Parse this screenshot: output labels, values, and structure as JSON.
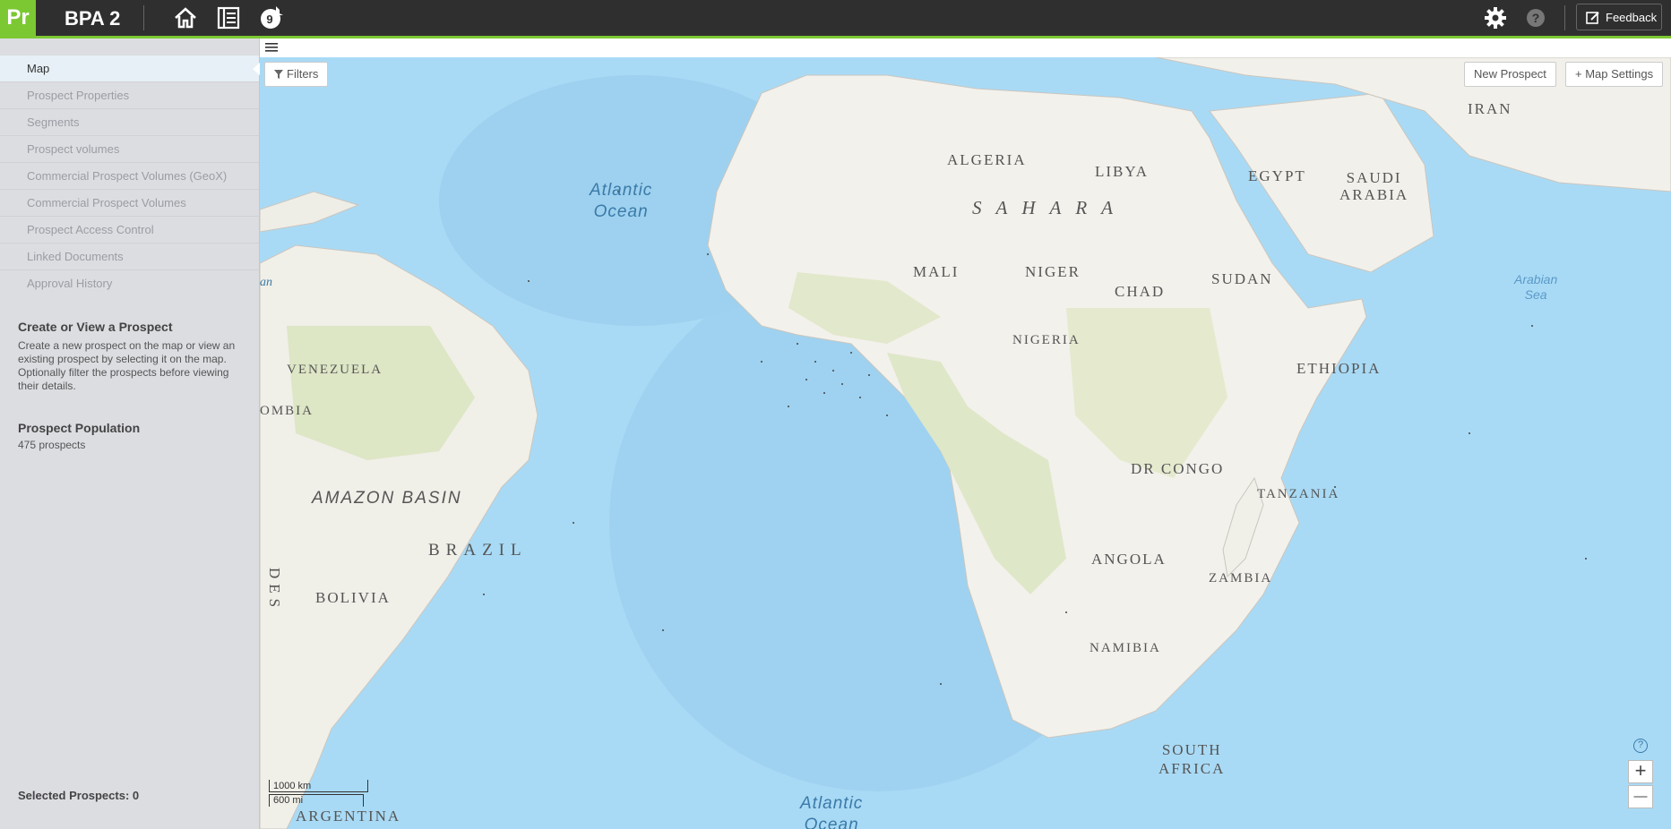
{
  "app": {
    "logo": "Pr",
    "title": "BPA 2",
    "notification_count": "9"
  },
  "topbar": {
    "feedback_label": "Feedback",
    "icons": [
      "home-icon",
      "list-icon",
      "notification-icon",
      "gear-icon",
      "help-icon",
      "feedback-icon"
    ]
  },
  "sidebar": {
    "items": [
      {
        "label": "Map",
        "active": true
      },
      {
        "label": "Prospect Properties"
      },
      {
        "label": "Segments"
      },
      {
        "label": "Prospect volumes"
      },
      {
        "label": "Commercial Prospect Volumes (GeoX)"
      },
      {
        "label": "Commercial Prospect Volumes"
      },
      {
        "label": "Prospect Access Control"
      },
      {
        "label": "Linked Documents"
      },
      {
        "label": "Approval History"
      }
    ],
    "create_title": "Create or View a Prospect",
    "create_text": "Create a new prospect on the map or view an existing prospect by selecting it on the map. Optionally filter the prospects before viewing their details.",
    "population_title": "Prospect Population",
    "population_value": "475 prospects",
    "selected_label": "Selected Prospects: 0"
  },
  "map": {
    "filters_label": "Filters",
    "new_prospect_label": "New Prospect",
    "map_settings_label": "+ Map Settings",
    "help_glyph": "?",
    "zoom_in": "+",
    "zoom_out": "—",
    "scale_km": "1000 km",
    "scale_mi": "600 mi",
    "labels": {
      "algeria": "ALGERIA",
      "libya": "LIBYA",
      "egypt": "EGYPT",
      "iran": "IRAN",
      "saudi": "SAUDI\nARABIA",
      "sahara": "SAHARA",
      "mali": "MALI",
      "niger": "NIGER",
      "chad": "CHAD",
      "sudan": "SUDAN",
      "nigeria": "NIGERIA",
      "ethiopia": "ETHIOPIA",
      "venezuela": "VENEZUELA",
      "colombia": "OMBIA",
      "amazon": "AMAZON BASIN",
      "brazil": "BRAZIL",
      "bolivia": "BOLIVIA",
      "des": "DES",
      "drc": "DR CONGO",
      "tanzania": "TANZANIA",
      "angola": "ANGOLA",
      "zambia": "ZAMBIA",
      "namibia": "NAMIBIA",
      "south_africa": "SOUTH\nAFRICA",
      "argentina": "ARGENTINA",
      "an": "an"
    },
    "oceans": {
      "atlantic_north": "Atlantic\nOcean",
      "atlantic_south": "Atlantic\nOcean",
      "arabian": "Arabian\nSea"
    }
  }
}
